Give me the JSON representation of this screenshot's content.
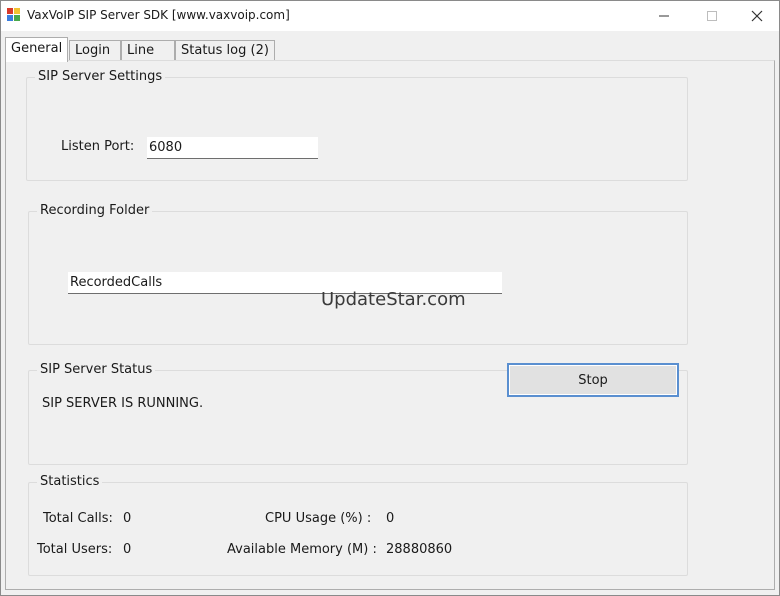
{
  "window": {
    "title": "VaxVoIP SIP Server SDK [www.vaxvoip.com]",
    "minimize_icon": "minimize-icon",
    "maximize_icon": "maximize-icon",
    "close_icon": "close-icon"
  },
  "tabs": [
    {
      "label": "General",
      "active": true
    },
    {
      "label": "Login"
    },
    {
      "label": "Line"
    },
    {
      "label": "Status log (2)"
    }
  ],
  "sip_settings": {
    "title": "SIP Server Settings",
    "listen_port_label": "Listen Port:",
    "listen_port_value": "6080"
  },
  "recording": {
    "title": "Recording Folder",
    "folder_value": "RecordedCalls"
  },
  "watermark": "UpdateStar.com",
  "status": {
    "title": "SIP Server Status",
    "message": "SIP SERVER IS RUNNING.",
    "stop_label": "Stop"
  },
  "statistics": {
    "title": "Statistics",
    "total_calls_label": "Total Calls:",
    "total_calls_value": "0",
    "total_users_label": "Total Users:",
    "total_users_value": "0",
    "cpu_label": "CPU Usage (%) :",
    "cpu_value": "0",
    "memory_label": "Available Memory (M) :",
    "memory_value": "28880860"
  },
  "colors": {
    "accent_border": "#5a8fd0",
    "window_bg": "#f0f0f0"
  }
}
